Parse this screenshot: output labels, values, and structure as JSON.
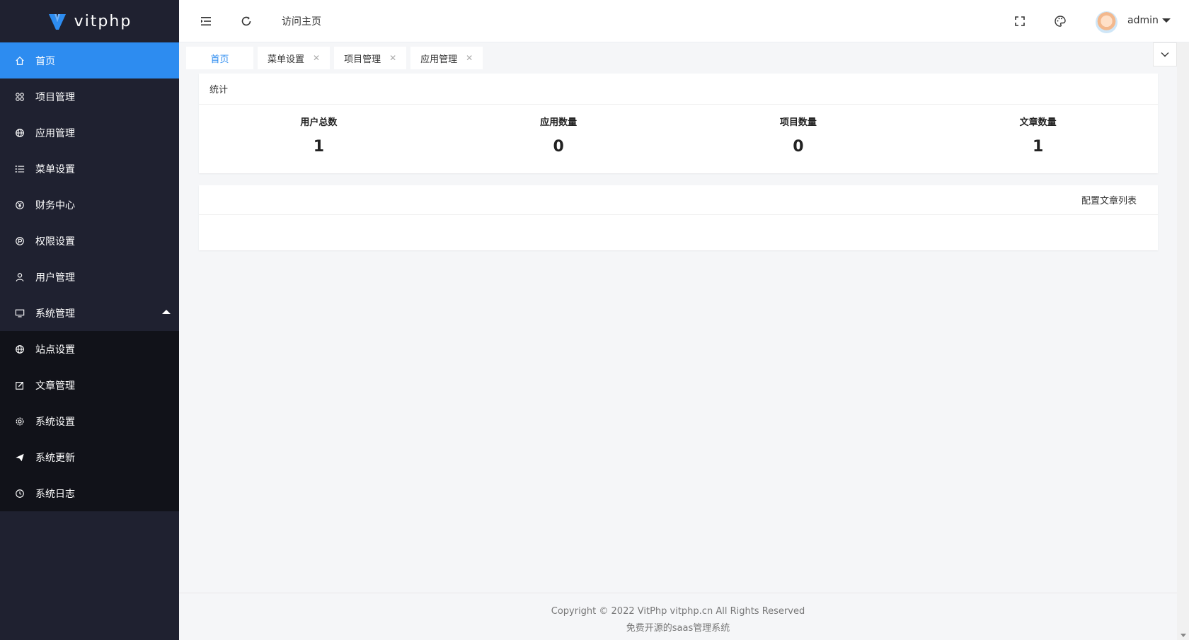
{
  "brand": {
    "name": "vitphp",
    "logo_icon": "v-logo-icon",
    "accent": "#2d8cf0"
  },
  "sidebar": {
    "items": [
      {
        "label": "首页",
        "icon": "home-icon",
        "active": true
      },
      {
        "label": "项目管理",
        "icon": "apps-icon"
      },
      {
        "label": "应用管理",
        "icon": "globe-icon"
      },
      {
        "label": "菜单设置",
        "icon": "list-icon"
      },
      {
        "label": "财务中心",
        "icon": "yen-icon"
      },
      {
        "label": "权限设置",
        "icon": "shield-icon"
      },
      {
        "label": "用户管理",
        "icon": "user-icon"
      },
      {
        "label": "系统管理",
        "icon": "monitor-icon",
        "expanded": true
      }
    ],
    "sub_items": [
      {
        "label": "站点设置",
        "icon": "globe-icon"
      },
      {
        "label": "文章管理",
        "icon": "edit-icon"
      },
      {
        "label": "系统设置",
        "icon": "gear-icon"
      },
      {
        "label": "系统更新",
        "icon": "send-icon"
      },
      {
        "label": "系统日志",
        "icon": "clock-icon"
      }
    ]
  },
  "header": {
    "visit_home": "访问主页",
    "user_name": "admin"
  },
  "tabs": [
    {
      "label": "首页",
      "active": true
    },
    {
      "label": "菜单设置",
      "closable": true
    },
    {
      "label": "项目管理",
      "closable": true
    },
    {
      "label": "应用管理",
      "closable": true
    }
  ],
  "stats": {
    "title": "统计",
    "items": [
      {
        "label": "用户总数",
        "value": "1"
      },
      {
        "label": "应用数量",
        "value": "0"
      },
      {
        "label": "项目数量",
        "value": "0"
      },
      {
        "label": "文章数量",
        "value": "1"
      }
    ]
  },
  "articles": {
    "config_link": "配置文章列表"
  },
  "footer": {
    "copyright": "Copyright © 2022 VitPhp vitphp.cn All Rights Reserved",
    "tagline": "免费开源的saas管理系统"
  }
}
